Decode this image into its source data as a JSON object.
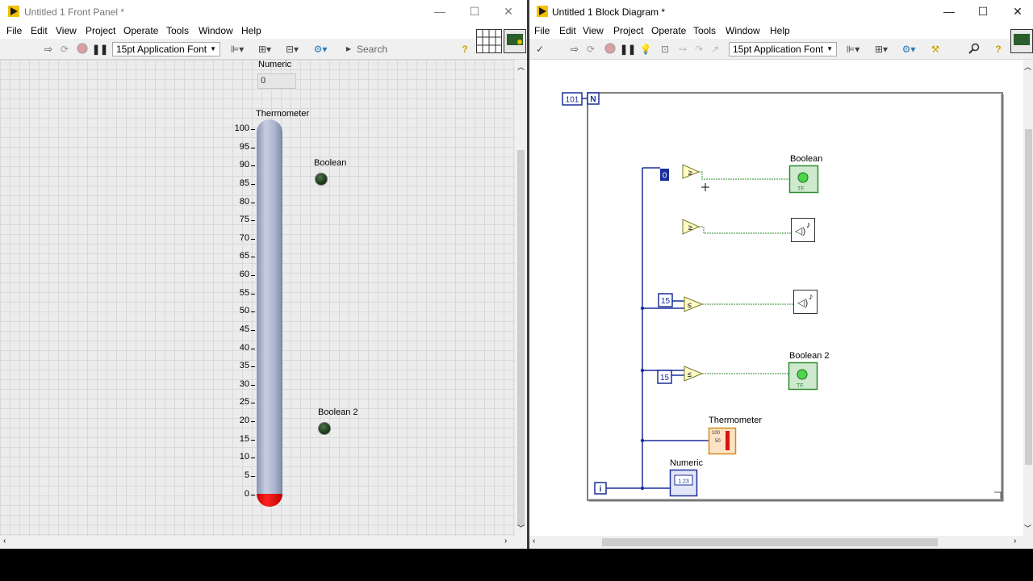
{
  "front_panel": {
    "title": "Untitled 1 Front Panel *",
    "menu": [
      "File",
      "Edit",
      "View",
      "Project",
      "Operate",
      "Tools",
      "Window",
      "Help"
    ],
    "font": "15pt Application Font",
    "search_placeholder": "Search",
    "numeric": {
      "label": "Numeric",
      "value": "0"
    },
    "thermometer": {
      "label": "Thermometer",
      "value": 0,
      "scale": [
        "100",
        "95",
        "90",
        "85",
        "80",
        "75",
        "70",
        "65",
        "60",
        "55",
        "50",
        "45",
        "40",
        "35",
        "30",
        "25",
        "20",
        "15",
        "10",
        "5",
        "0"
      ]
    },
    "boolean1": {
      "label": "Boolean"
    },
    "boolean2": {
      "label": "Boolean 2"
    }
  },
  "block_diagram": {
    "title": "Untitled 1 Block Diagram *",
    "menu": [
      "File",
      "Edit",
      "View",
      "Project",
      "Operate",
      "Tools",
      "Window",
      "Help"
    ],
    "font": "15pt Application Font",
    "loop_count": "101",
    "loop_n": "N",
    "loop_i": "i",
    "const_zero": "0",
    "const_15a": "15",
    "const_15b": "15",
    "boolean_terminal_label": "Boolean",
    "boolean2_terminal_label": "Boolean 2",
    "thermometer_terminal_label": "Thermometer",
    "numeric_terminal_label": "Numeric",
    "numeric_terminal_text": "1.23",
    "thermometer_icon_text": [
      "100",
      "50"
    ]
  }
}
